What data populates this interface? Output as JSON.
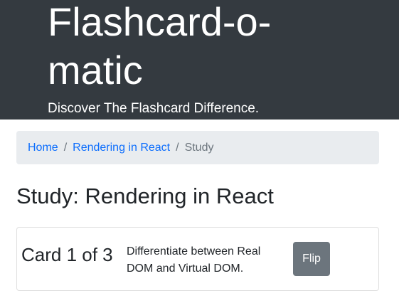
{
  "header": {
    "title": "Flashcard-o-matic",
    "subtitle": "Discover The Flashcard Difference."
  },
  "breadcrumb": {
    "home": "Home",
    "deck": "Rendering in React",
    "current": "Study",
    "separator": "/"
  },
  "study": {
    "title": "Study: Rendering in React"
  },
  "card": {
    "counter": "Card 1 of 3",
    "front": "Differentiate between Real DOM and Virtual DOM.",
    "flip_label": "Flip"
  }
}
